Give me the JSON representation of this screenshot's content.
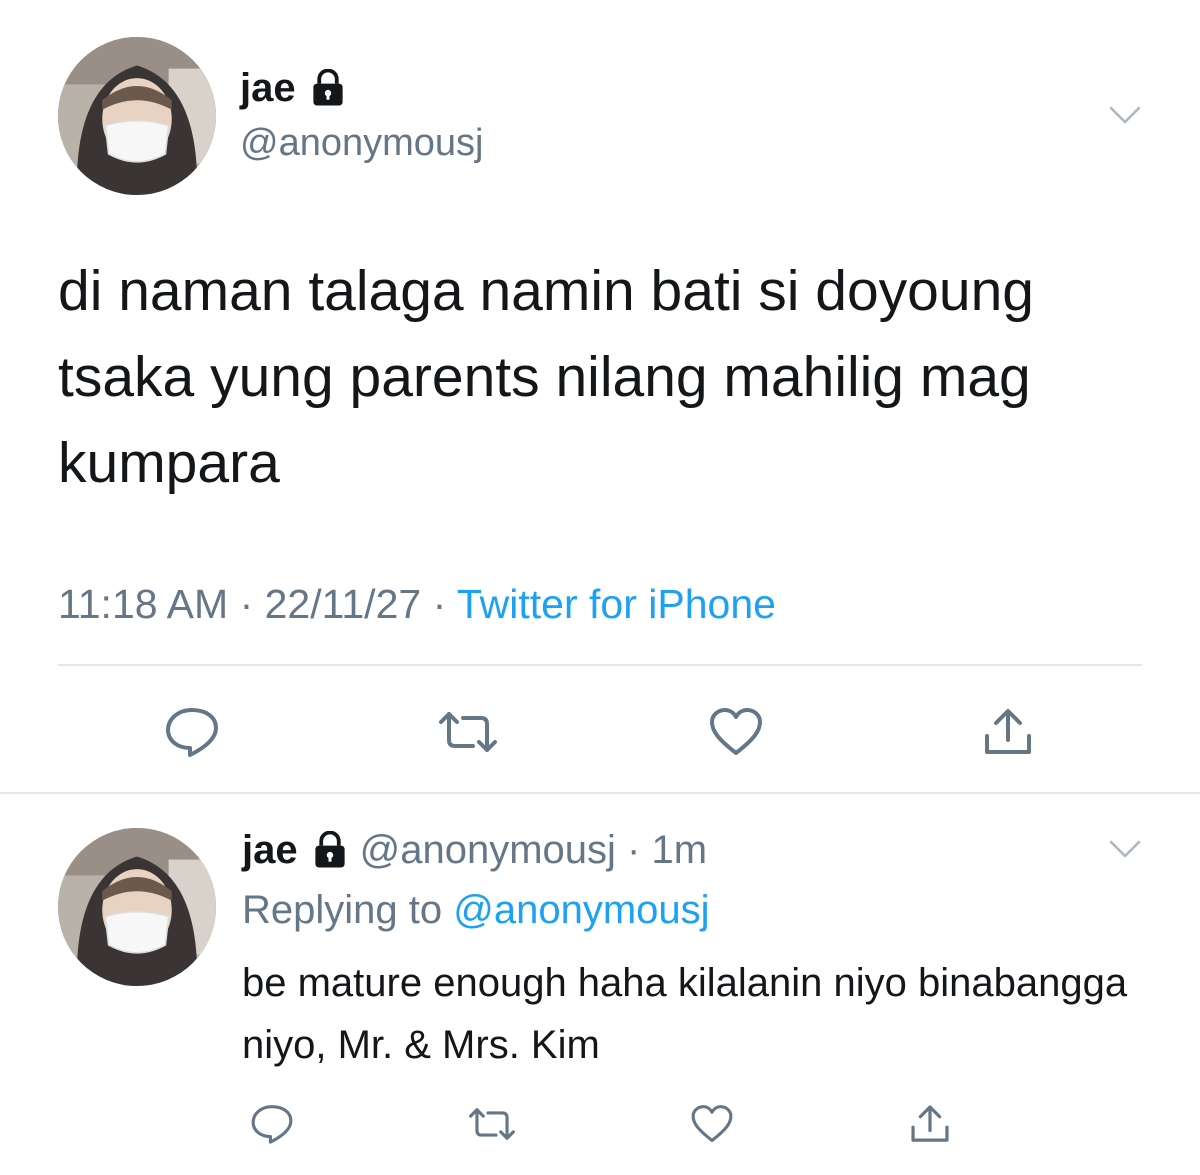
{
  "main_tweet": {
    "display_name": "jae",
    "handle": "@anonymousj",
    "text": "di naman talaga namin bati si doyoung tsaka yung parents nilang mahilig mag kumpara",
    "time": "11:18 AM",
    "date": "22/11/27",
    "source": "Twitter for iPhone",
    "separator": " · ",
    "icons": {
      "lock": "lock-icon",
      "menu": "chevron-down-icon",
      "reply": "reply-icon",
      "retweet": "retweet-icon",
      "like": "heart-icon",
      "share": "share-icon"
    }
  },
  "reply_tweet": {
    "display_name": "jae",
    "handle": "@anonymousj",
    "time_ago": "1m",
    "handle_time": "@anonymousj · 1m",
    "replying_to_label": "Replying to ",
    "replying_to_mention": "@anonymousj",
    "text": "be mature enough haha kilalanin niyo binabangga niyo, Mr. & Mrs. Kim"
  },
  "colors": {
    "text": "#14171a",
    "secondary": "#657786",
    "link": "#1da1f2",
    "divider": "#e1e8ed"
  }
}
